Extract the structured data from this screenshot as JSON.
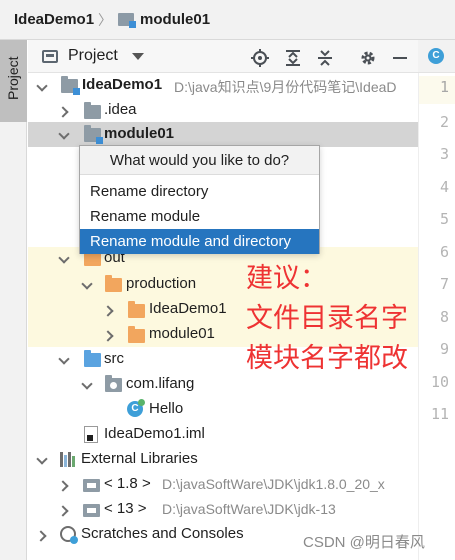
{
  "breadcrumb": {
    "project": "IdeaDemo1",
    "module": "module01"
  },
  "toolstrip": {
    "project_tab": "Project"
  },
  "project_view": {
    "title": "Project"
  },
  "editor": {
    "line_numbers": [
      "1",
      "2",
      "3",
      "4",
      "5",
      "6",
      "7",
      "8",
      "9",
      "10",
      "11"
    ]
  },
  "tree": {
    "root": {
      "label": "IdeaDemo1",
      "path": "D:\\java知识点\\9月份代码笔记\\IdeaD"
    },
    "idea": {
      "label": ".idea"
    },
    "module01": {
      "label": "module01"
    },
    "out": {
      "label": "out"
    },
    "production": {
      "label": "production"
    },
    "prod_ideademo1": {
      "label": "IdeaDemo1"
    },
    "prod_module01": {
      "label": "module01"
    },
    "src": {
      "label": "src"
    },
    "package": {
      "label": "com.lifang"
    },
    "hello": {
      "label": "Hello"
    },
    "iml": {
      "label": "IdeaDemo1.iml"
    },
    "external_libraries": {
      "label": "External Libraries"
    },
    "jdk18": {
      "label": "< 1.8 >",
      "path": "D:\\javaSoftWare\\JDK\\jdk1.8.0_20_x"
    },
    "jdk13": {
      "label": "< 13 >",
      "path": "D:\\javaSoftWare\\JDK\\jdk-13"
    },
    "scratches": {
      "label": "Scratches and Consoles"
    }
  },
  "popup": {
    "title": "What would you like to do?",
    "items": [
      "Rename directory",
      "Rename module",
      "Rename module and directory"
    ],
    "selected_index": 2
  },
  "annotation": {
    "line1": "建议：",
    "line2": "文件目录名字",
    "line3": "模块名字都改",
    "color": "#ee3333"
  },
  "watermark": "CSDN @明日春风"
}
